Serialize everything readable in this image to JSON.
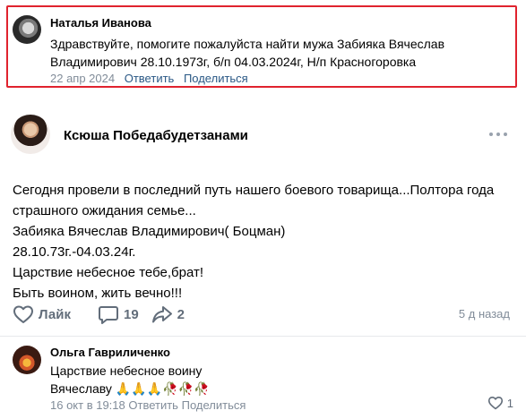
{
  "highlighted_comment": {
    "author": "Наталья Иванова",
    "text_line1": "Здравствуйте, помогите пожалуйста найти мужа Забияка Вячеслав",
    "text_line2": "Владимирович 28.10.1973г, б/п 04.03.2024г, Н/п Красногоровка",
    "date": "22 апр 2024",
    "reply_label": "Ответить",
    "share_label": "Поделиться",
    "highlight_color": "#e0232e"
  },
  "post": {
    "author": "Ксюша Победабудетзанами",
    "body_lines": [
      "Сегодня провели в последний путь нашего боевого товарища...Полтора года",
      "страшного ожидания семье...",
      "Забияка Вячеслав Владимирович( Боцман)",
      "28.10.73г.-04.03.24г.",
      "Царствие небесное тебе,брат!",
      "Быть воином, жить вечно!!!"
    ],
    "like_label": "Лайк",
    "comments_count": "19",
    "shares_count": "2",
    "date": "5 д назад",
    "more_icon": "more-dots-icon"
  },
  "comment2": {
    "author": "Ольга Гавриличенко",
    "text_line1": "Царствие небесное воину",
    "text_line2_word": "Вячеславу",
    "text_line2_emoji": "🙏🙏🙏🥀🥀🥀",
    "date": "16 окт в 19:18",
    "reply_label": "Ответить",
    "share_label": "Поделиться",
    "likes_count": "1"
  },
  "colors": {
    "link": "#2a5885",
    "meta": "#818c99",
    "icon": "#626d7a"
  }
}
